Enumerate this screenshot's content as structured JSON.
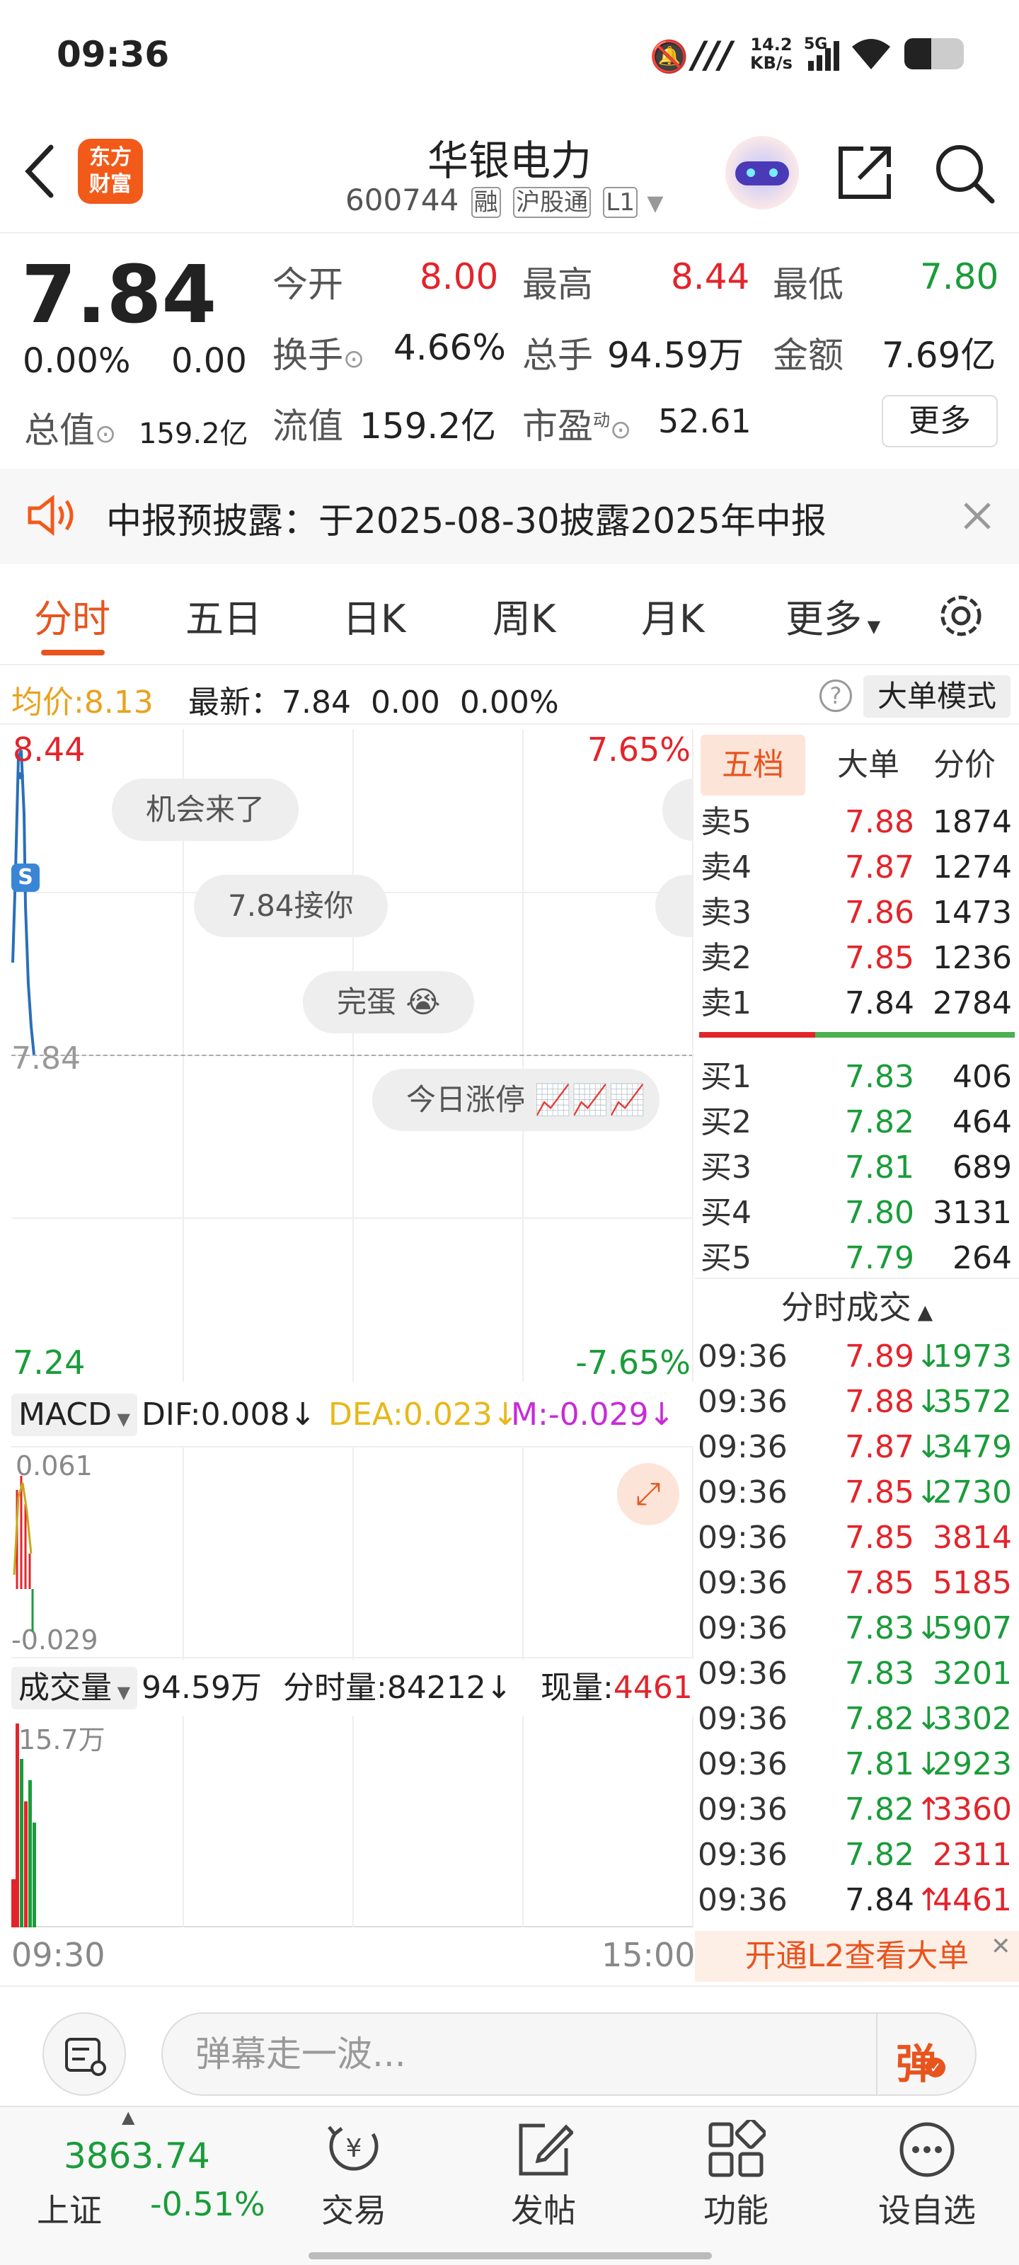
{
  "status": {
    "time": "09:36",
    "speed_top": "14.2",
    "speed_bottom": "KB/s",
    "network": "5G"
  },
  "header": {
    "title": "华银电力",
    "code": "600744",
    "tags": [
      "融",
      "沪股通",
      "L1"
    ],
    "logo_line1": "东方",
    "logo_line2": "财富"
  },
  "quote": {
    "price": "7.84",
    "change_pct": "0.00%",
    "change": "0.00",
    "open_label": "今开",
    "open": "8.00",
    "high_label": "最高",
    "high": "8.44",
    "low_label": "最低",
    "low": "7.80",
    "turnover_label": "换手",
    "turnover": "4.66%",
    "volume_label": "总手",
    "volume": "94.59万",
    "amount_label": "金额",
    "amount": "7.69亿",
    "mktcap_label": "总值",
    "mktcap": "159.2亿",
    "float_label": "流值",
    "float": "159.2亿",
    "pe_label": "市盈",
    "pe_sup": "动",
    "pe": "52.61",
    "more": "更多"
  },
  "notice": {
    "text": "中报预披露：于2025-08-30披露2025年中报"
  },
  "tabs": [
    "分时",
    "五日",
    "日K",
    "周K",
    "月K",
    "更多"
  ],
  "infobar": {
    "avg_label": "均价:",
    "avg": "8.13",
    "latest": "最新：7.84  0.00  0.00%",
    "mode": "大单模式"
  },
  "chart": {
    "ymax": "8.44",
    "ymin": "7.24",
    "pct_max": "7.65%",
    "pct_min": "-7.65%",
    "mid": "7.84",
    "t_start": "09:30",
    "t_end": "15:00",
    "danmaku": [
      "机会来了",
      "7.84接你",
      "完蛋",
      "今日涨停"
    ]
  },
  "macd": {
    "label": "MACD",
    "dif": "DIF:0.008",
    "dea": "DEA:0.023",
    "m": "M:-0.029",
    "top": "0.061",
    "bottom": "-0.029"
  },
  "vol": {
    "label": "成交量",
    "total": "94.59万",
    "per": "分时量:84212",
    "now_label": "现量:",
    "now": "4461",
    "scale": "15.7万"
  },
  "book": {
    "tabs": [
      "五档",
      "大单",
      "分价"
    ],
    "asks": [
      {
        "l": "卖5",
        "p": "7.88",
        "v": "1874"
      },
      {
        "l": "卖4",
        "p": "7.87",
        "v": "1274"
      },
      {
        "l": "卖3",
        "p": "7.86",
        "v": "1473"
      },
      {
        "l": "卖2",
        "p": "7.85",
        "v": "1236"
      },
      {
        "l": "卖1",
        "p": "7.84",
        "v": "2784"
      }
    ],
    "bids": [
      {
        "l": "买1",
        "p": "7.83",
        "v": "406"
      },
      {
        "l": "买2",
        "p": "7.82",
        "v": "464"
      },
      {
        "l": "买3",
        "p": "7.81",
        "v": "689"
      },
      {
        "l": "买4",
        "p": "7.80",
        "v": "3131"
      },
      {
        "l": "买5",
        "p": "7.79",
        "v": "264"
      }
    ]
  },
  "ticks_title": "分时成交",
  "ticks": [
    {
      "t": "09:36",
      "p": "7.89",
      "d": "↓",
      "v": "1973",
      "pc": "red",
      "vc": "green"
    },
    {
      "t": "09:36",
      "p": "7.88",
      "d": "↓",
      "v": "3572",
      "pc": "red",
      "vc": "green"
    },
    {
      "t": "09:36",
      "p": "7.87",
      "d": "↓",
      "v": "3479",
      "pc": "red",
      "vc": "green"
    },
    {
      "t": "09:36",
      "p": "7.85",
      "d": "↓",
      "v": "2730",
      "pc": "red",
      "vc": "green"
    },
    {
      "t": "09:36",
      "p": "7.85",
      "d": "",
      "v": "3814",
      "pc": "red",
      "vc": "red"
    },
    {
      "t": "09:36",
      "p": "7.85",
      "d": "",
      "v": "5185",
      "pc": "red",
      "vc": "red"
    },
    {
      "t": "09:36",
      "p": "7.83",
      "d": "↓",
      "v": "5907",
      "pc": "green",
      "vc": "green"
    },
    {
      "t": "09:36",
      "p": "7.83",
      "d": "",
      "v": "3201",
      "pc": "green",
      "vc": "green"
    },
    {
      "t": "09:36",
      "p": "7.82",
      "d": "↓",
      "v": "3302",
      "pc": "green",
      "vc": "green"
    },
    {
      "t": "09:36",
      "p": "7.81",
      "d": "↓",
      "v": "2923",
      "pc": "green",
      "vc": "green"
    },
    {
      "t": "09:36",
      "p": "7.82",
      "d": "↑",
      "v": "3360",
      "pc": "green",
      "vc": "red"
    },
    {
      "t": "09:36",
      "p": "7.82",
      "d": "",
      "v": "2311",
      "pc": "green",
      "vc": "red"
    },
    {
      "t": "09:36",
      "p": "7.84",
      "d": "↑",
      "v": "4461",
      "pc": "dark",
      "vc": "red"
    }
  ],
  "l2_banner": "开通L2查看大单",
  "comment": {
    "placeholder": "弹幕走一波...",
    "send": "弹"
  },
  "bottom": {
    "index_value": "3863.74",
    "index_name": "上证",
    "index_change": "-0.51%",
    "nav": [
      "交易",
      "发帖",
      "功能",
      "设自选"
    ]
  }
}
